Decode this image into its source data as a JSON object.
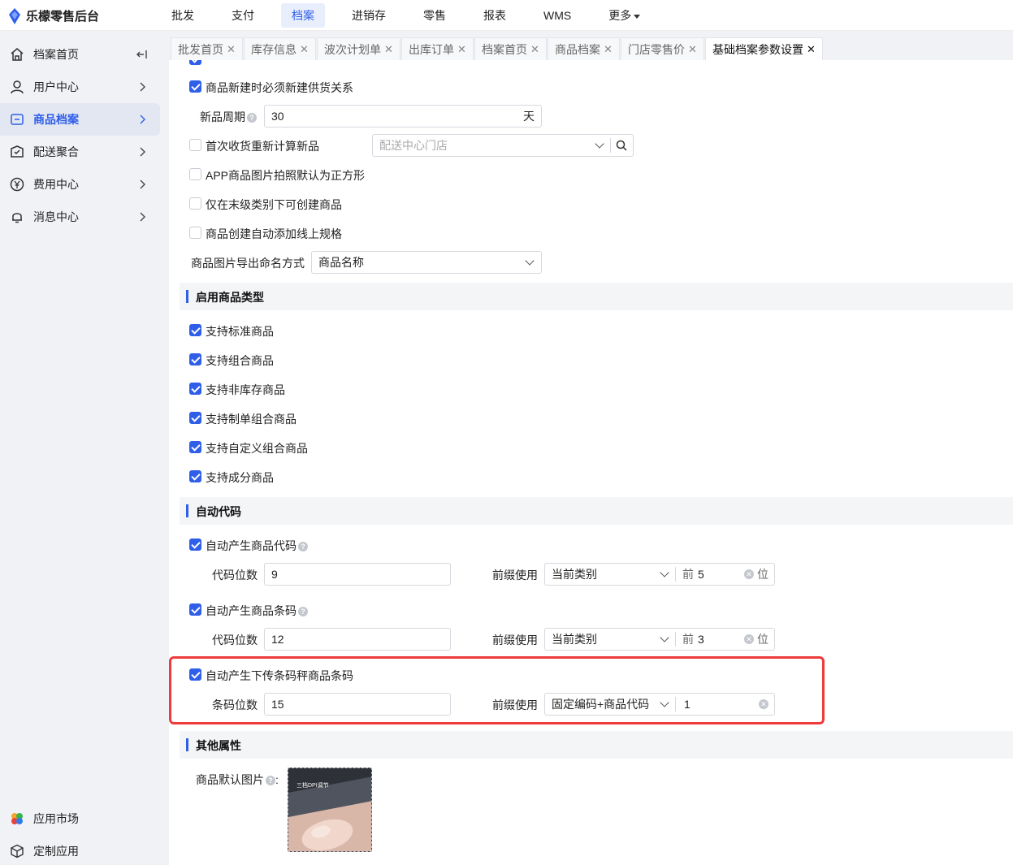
{
  "app": {
    "title": "乐檬零售后台",
    "brand_color": "#2f5ee8"
  },
  "topnav": [
    {
      "label": "批发",
      "active": false
    },
    {
      "label": "支付",
      "active": false
    },
    {
      "label": "档案",
      "active": true
    },
    {
      "label": "进销存",
      "active": false
    },
    {
      "label": "零售",
      "active": false
    },
    {
      "label": "报表",
      "active": false
    },
    {
      "label": "WMS",
      "active": false
    },
    {
      "label": "更多",
      "active": false
    }
  ],
  "sidebar": {
    "items": [
      {
        "label": "档案首页",
        "icon": "home-icon",
        "arrow": "collapse-icon"
      },
      {
        "label": "用户中心",
        "icon": "user-icon",
        "arrow": "chevron-right-icon"
      },
      {
        "label": "商品档案",
        "icon": "product-icon",
        "arrow": "chevron-right-icon",
        "active": true
      },
      {
        "label": "配送聚合",
        "icon": "delivery-icon",
        "arrow": "chevron-right-icon"
      },
      {
        "label": "费用中心",
        "icon": "yen-icon",
        "arrow": "chevron-right-icon"
      },
      {
        "label": "消息中心",
        "icon": "bell-icon",
        "arrow": "chevron-right-icon"
      }
    ],
    "bottom": [
      {
        "label": "应用市场",
        "icon": "app-market-icon"
      },
      {
        "label": "定制应用",
        "icon": "custom-app-icon"
      }
    ]
  },
  "tabs": [
    {
      "label": "批发首页"
    },
    {
      "label": "库存信息"
    },
    {
      "label": "波次计划单"
    },
    {
      "label": "出库订单"
    },
    {
      "label": "档案首页"
    },
    {
      "label": "商品档案"
    },
    {
      "label": "门店零售价"
    },
    {
      "label": "基础档案参数设置",
      "active": true
    }
  ],
  "form": {
    "must_create_supply": {
      "label": "商品新建时必须新建供货关系",
      "checked": true
    },
    "new_cycle": {
      "label": "新品周期",
      "value": "30",
      "unit": "天"
    },
    "first_receive": {
      "label": "首次收货重新计算新品",
      "checked": false,
      "select_placeholder": "配送中心门店"
    },
    "app_square": {
      "label": "APP商品图片拍照默认为正方形",
      "checked": false
    },
    "last_level_only": {
      "label": "仅在末级类别下可创建商品",
      "checked": false
    },
    "auto_online_spec": {
      "label": "商品创建自动添加线上规格",
      "checked": false
    },
    "image_export": {
      "label": "商品图片导出命名方式",
      "value": "商品名称"
    }
  },
  "sections": {
    "product_types": {
      "title": "启用商品类型",
      "items": [
        {
          "label": "支持标准商品",
          "checked": true
        },
        {
          "label": "支持组合商品",
          "checked": true
        },
        {
          "label": "支持非库存商品",
          "checked": true
        },
        {
          "label": "支持制单组合商品",
          "checked": true
        },
        {
          "label": "支持自定义组合商品",
          "checked": true
        },
        {
          "label": "支持成分商品",
          "checked": true
        }
      ]
    },
    "auto_code": {
      "title": "自动代码",
      "product_code": {
        "label": "自动产生商品代码",
        "checked": true,
        "digits_label": "代码位数",
        "digits": "9",
        "prefix_label": "前缀使用",
        "prefix": "当前类别",
        "front_label": "前",
        "front_value": "5",
        "unit": "位"
      },
      "product_barcode": {
        "label": "自动产生商品条码",
        "checked": true,
        "digits_label": "代码位数",
        "digits": "12",
        "prefix_label": "前缀使用",
        "prefix": "当前类别",
        "front_label": "前",
        "front_value": "3",
        "unit": "位"
      },
      "scale_barcode": {
        "label": "自动产生下传条码秤商品条码",
        "checked": true,
        "digits_label": "条码位数",
        "digits": "15",
        "prefix_label": "前缀使用",
        "prefix": "固定编码+商品代码",
        "fixed_value": "1"
      }
    },
    "other": {
      "title": "其他属性",
      "default_image_label": "商品默认图片",
      "colon": ":",
      "image_caption": "三档DPI调节"
    }
  }
}
